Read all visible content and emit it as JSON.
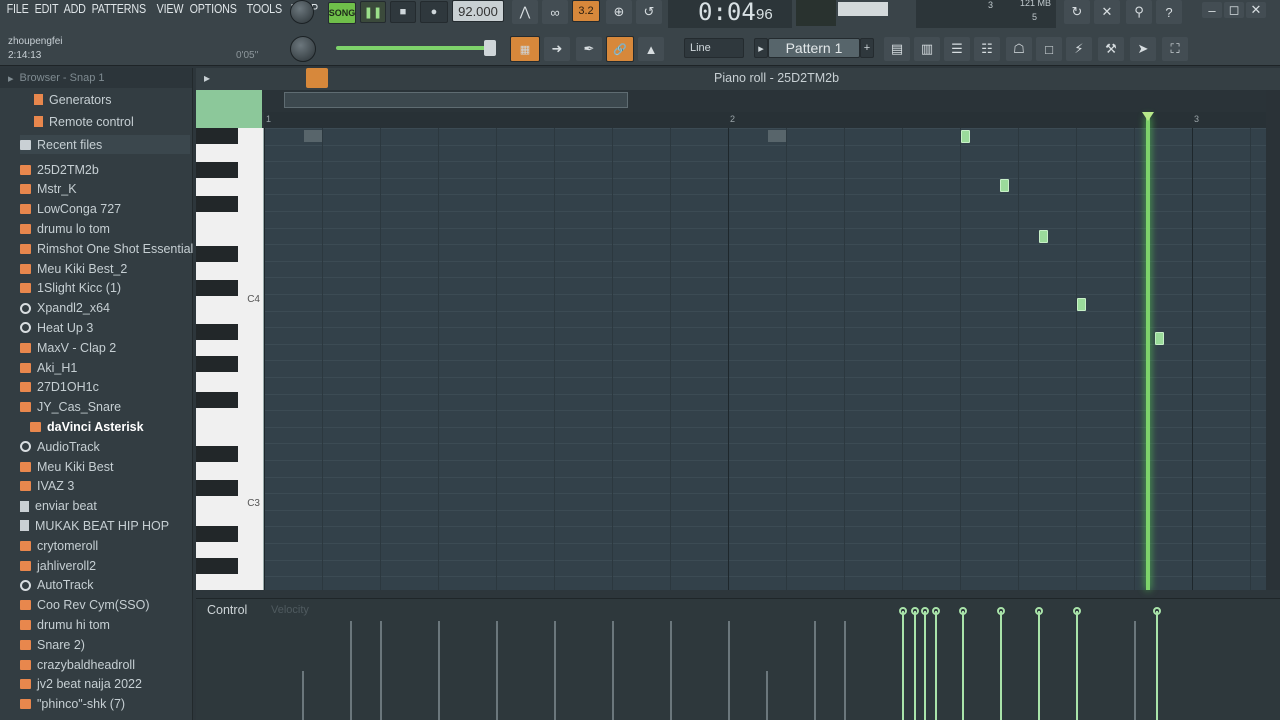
{
  "menu": [
    "FILE",
    "EDIT",
    "ADD",
    "PATTERNS",
    "VIEW",
    "OPTIONS",
    "TOOLS",
    "HELP"
  ],
  "user": {
    "name": "zhoupengfei",
    "time": "2:14:13",
    "hint": "0'05''"
  },
  "transport": {
    "song_label": "SONG",
    "tempo": "92.000",
    "time": "0:04",
    "time_sub": "96",
    "step_label": "3.2",
    "snap_mode": "Line",
    "pattern": "Pattern 1",
    "cpu_mem": "121 MB",
    "cpu_a": "3",
    "cpu_b": "5"
  },
  "browser": {
    "header": "Browser - Snap 1",
    "sections": [
      "Generators",
      "Remote control",
      "Recent files"
    ],
    "items": [
      {
        "label": "25D2TM2b",
        "icon": "folder"
      },
      {
        "label": "Mstr_K",
        "icon": "folder"
      },
      {
        "label": "LowConga 727",
        "icon": "folder"
      },
      {
        "label": "drumu lo tom",
        "icon": "folder"
      },
      {
        "label": "Rimshot One Shot Essential",
        "icon": "folder"
      },
      {
        "label": "Meu Kiki Best_2",
        "icon": "folder"
      },
      {
        "label": "1Slight Kicc (1)",
        "icon": "folder"
      },
      {
        "label": "Xpandl2_x64",
        "icon": "gear"
      },
      {
        "label": "Heat Up 3",
        "icon": "gear"
      },
      {
        "label": "MaxV - Clap 2",
        "icon": "folder"
      },
      {
        "label": "Aki_H1",
        "icon": "folder"
      },
      {
        "label": "27D1OH1c",
        "icon": "folder"
      },
      {
        "label": "JY_Cas_Snare",
        "icon": "folder"
      },
      {
        "label": "daVinci Asterisk",
        "icon": "folder"
      },
      {
        "label": "AudioTrack",
        "icon": "gear"
      },
      {
        "label": "Meu Kiki Best",
        "icon": "folder"
      },
      {
        "label": "IVAZ 3",
        "icon": "folder"
      },
      {
        "label": "enviar beat",
        "icon": "file"
      },
      {
        "label": "MUKAK BEAT HIP HOP",
        "icon": "file"
      },
      {
        "label": "crytomeroll",
        "icon": "folder"
      },
      {
        "label": "jahliveroll2",
        "icon": "folder"
      },
      {
        "label": "AutoTrack",
        "icon": "gear"
      },
      {
        "label": "Coo Rev Cym(SSO)",
        "icon": "folder"
      },
      {
        "label": "drumu hi tom",
        "icon": "folder"
      },
      {
        "label": "Snare 2)",
        "icon": "folder"
      },
      {
        "label": "crazybaldheadroll",
        "icon": "folder"
      },
      {
        "label": "jv2 beat naija 2022",
        "icon": "folder"
      },
      {
        "label": "\"phinco\"-shk (7)",
        "icon": "folder"
      }
    ]
  },
  "piano_roll": {
    "title": "Piano roll - 25D2TM2b",
    "key_labels": [
      "C4",
      "C3"
    ],
    "bars": [
      "1",
      "2",
      "3"
    ],
    "control_label": "Control",
    "control_param": "Velocity"
  },
  "colors": {
    "note": "#9bdb9b",
    "playhead": "#7ed36b",
    "grid_bg": "#33414a"
  }
}
